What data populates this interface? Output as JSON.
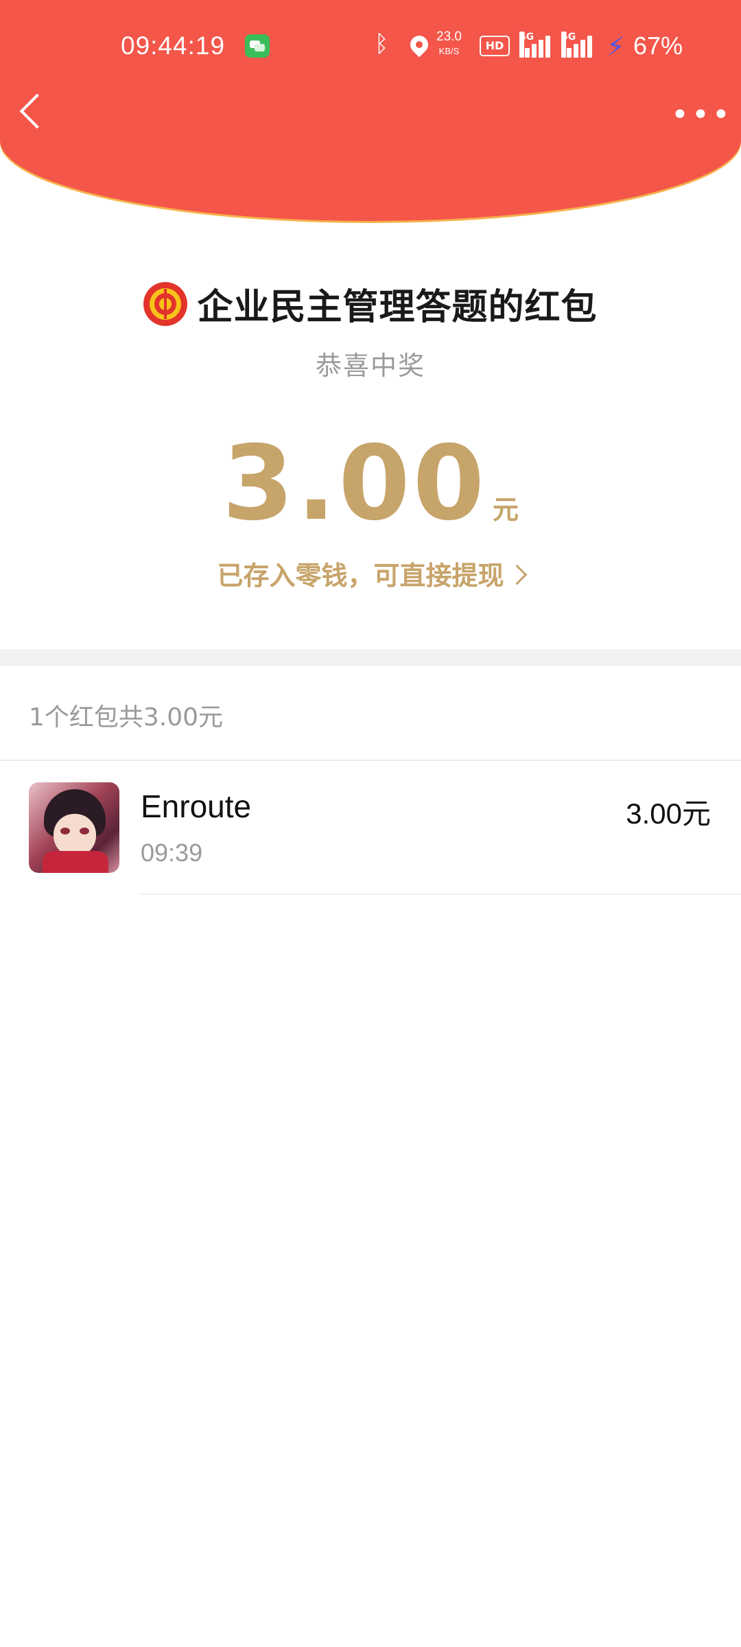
{
  "status_bar": {
    "time": "09:44:19",
    "net_speed_value": "23.0",
    "net_speed_unit": "KB/S",
    "hd_label": "HD",
    "signal1_label": "4G",
    "signal2_label": "5G",
    "battery": "67%"
  },
  "header": {
    "back_icon": "chevron-left-icon",
    "more_icon": "more-dots-icon",
    "color": "#f4564a"
  },
  "packet": {
    "title": "企业民主管理答题的红包",
    "subtitle": "恭喜中奖",
    "amount": "3.00",
    "unit": "元",
    "saved_text": "已存入零钱，可直接提现",
    "accent_color": "#c7a46a"
  },
  "summary": {
    "text": "1个红包共3.00元"
  },
  "records": [
    {
      "name": "Enroute",
      "time": "09:39",
      "amount": "3.00元"
    }
  ]
}
